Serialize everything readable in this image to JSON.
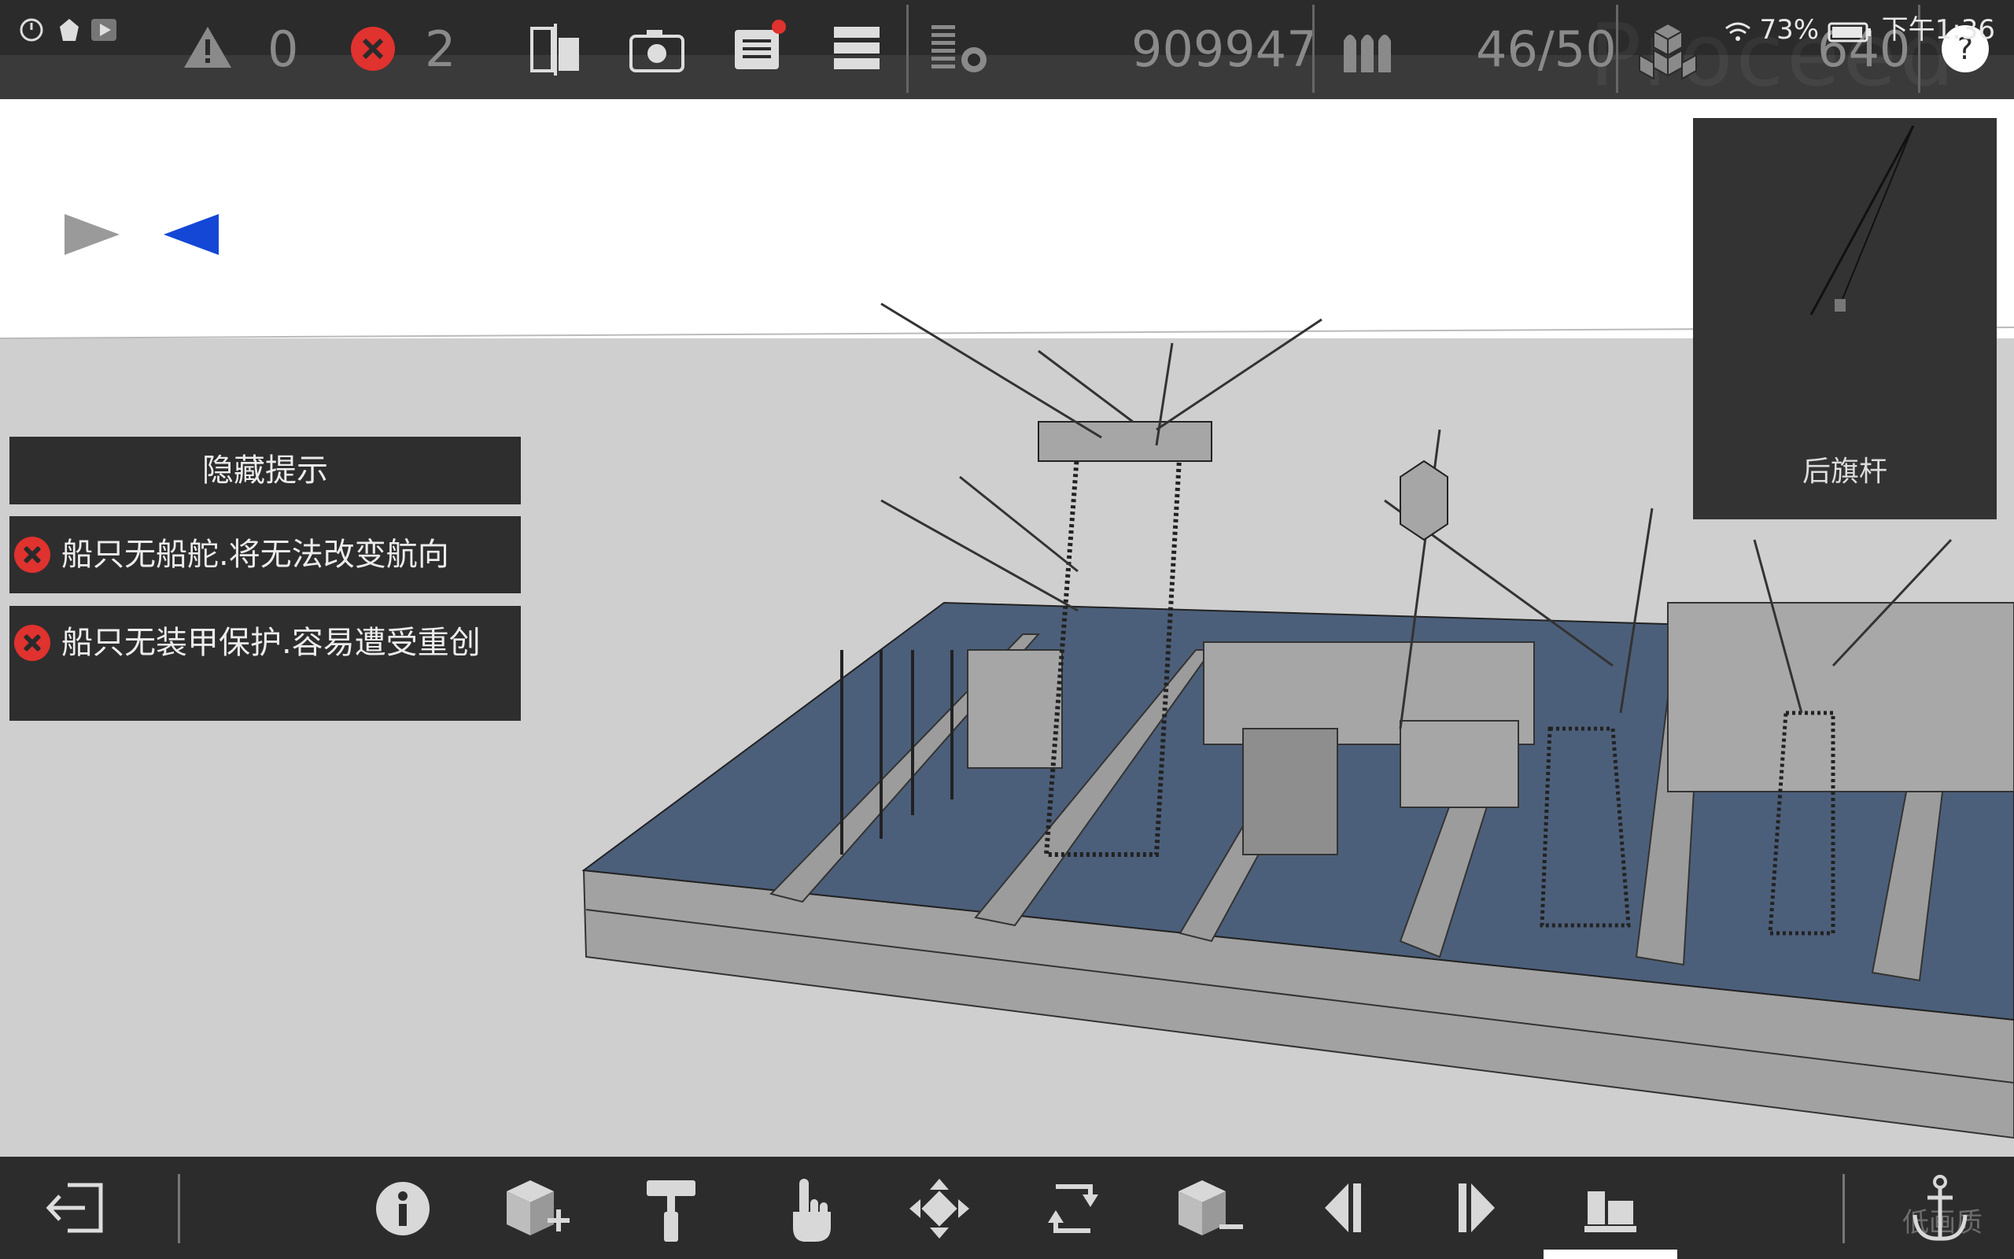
{
  "topbar": {
    "warning_count": "0",
    "error_count": "2",
    "mass_value": "909947",
    "ammo_value": "46/50",
    "parts_value": "640",
    "watermark_text": "Proceed"
  },
  "status": {
    "wifi": "73%",
    "time": "下午1:36"
  },
  "preview": {
    "label": "后旗杆"
  },
  "hints": {
    "toggle_label": "隐藏提示",
    "errors": [
      "船只无船舵.将无法改变航向",
      "船只无装甲保护.容易遭受重创"
    ]
  },
  "bottombar": {
    "ghost_text": "低画质",
    "active_tool": "place-part"
  },
  "colors": {
    "bar": "#2b2b2b",
    "deck": "#4c5f7a",
    "hull": "#9a9a9a",
    "error": "#e0322e",
    "arrow_active": "#1447d6",
    "arrow_inactive": "#9a9a9a"
  }
}
